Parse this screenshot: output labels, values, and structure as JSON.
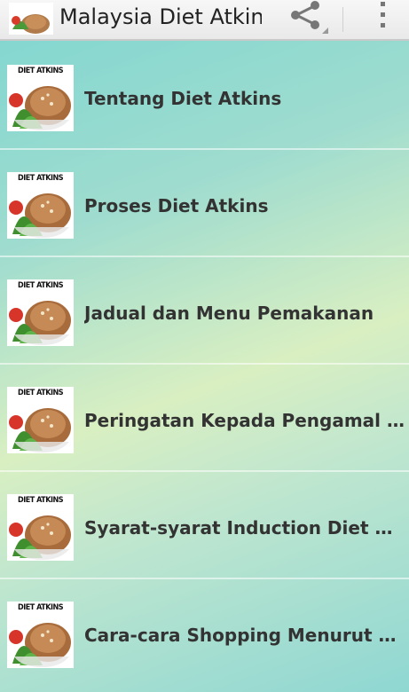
{
  "app": {
    "title": "Malaysia Diet Atkins",
    "thumb_text": "DIET ATKINS",
    "icons": {
      "share": "share-icon",
      "overflow": "overflow-menu-icon"
    }
  },
  "list": [
    {
      "label": "Tentang Diet Atkins"
    },
    {
      "label": "Proses Diet Atkins"
    },
    {
      "label": "Jadual dan Menu Pemakanan"
    },
    {
      "label": "Peringatan Kepada Pengamal Diet Atkins"
    },
    {
      "label": "Syarat-syarat Induction Diet Atkins"
    },
    {
      "label": "Cara-cara Shopping Menurut Diet Atkins"
    }
  ]
}
